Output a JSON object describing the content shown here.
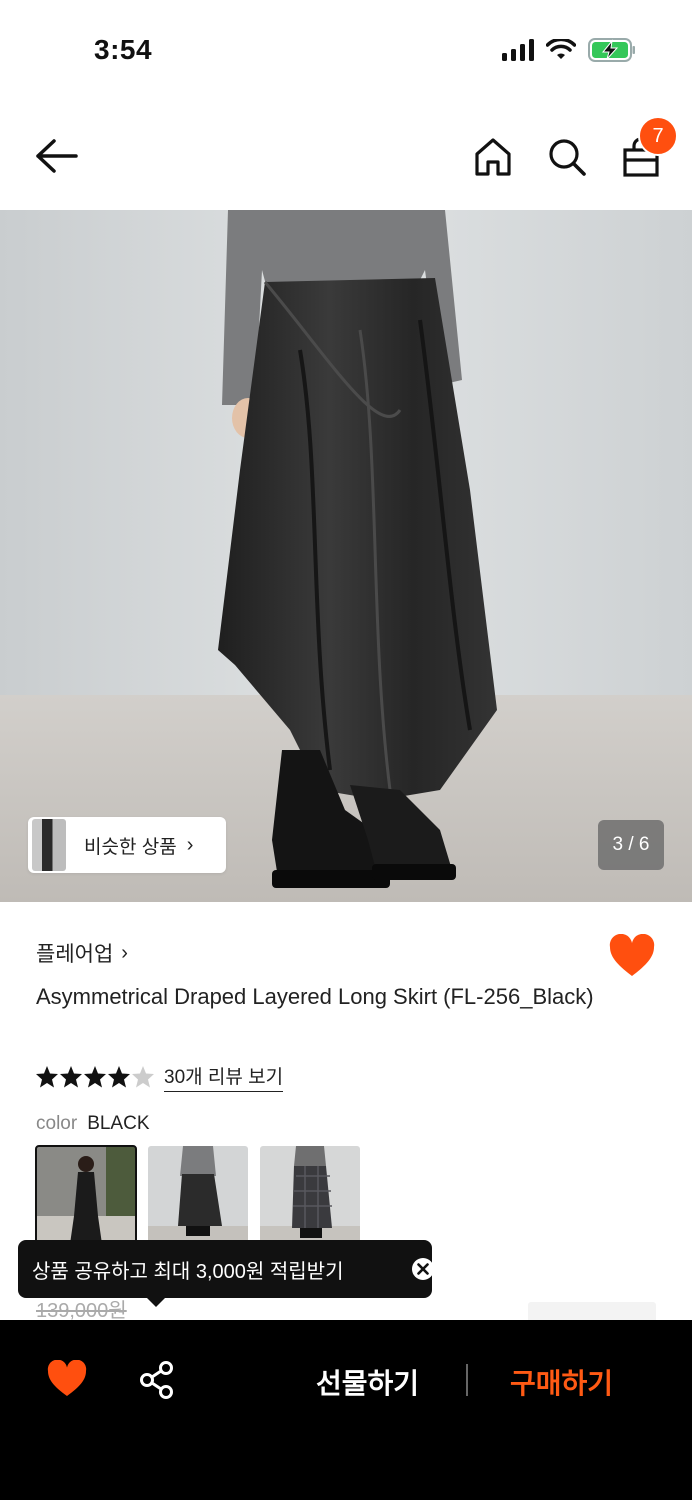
{
  "status_bar": {
    "time": "3:54",
    "icons": [
      "signal-icon",
      "wifi-icon",
      "battery-charging-icon"
    ]
  },
  "nav": {
    "icons": [
      "back-arrow-icon",
      "home-icon",
      "search-icon",
      "shopping-bag-icon"
    ],
    "cart_count": "7"
  },
  "gallery": {
    "similar_label": "비슷한 상품",
    "similar_chevron": "›",
    "page_indicator": "3 / 6"
  },
  "product": {
    "brand": "플레어업",
    "brand_chevron": "›",
    "title": "Asymmetrical Draped Layered Long Skirt (FL-256_Black)",
    "rating": 4.5,
    "review_link": "30개 리뷰 보기",
    "color_label": "color",
    "color_value": "BLACK",
    "old_price": "139,000원"
  },
  "tooltip": {
    "text": "상품 공유하고 최대 3,000원 적립받기"
  },
  "bottom_bar": {
    "gift_label": "선물하기",
    "buy_label": "구매하기"
  },
  "colors": {
    "accent": "#ff4f0f",
    "buy": "#ff5a14",
    "bar_bg": "#000000"
  }
}
